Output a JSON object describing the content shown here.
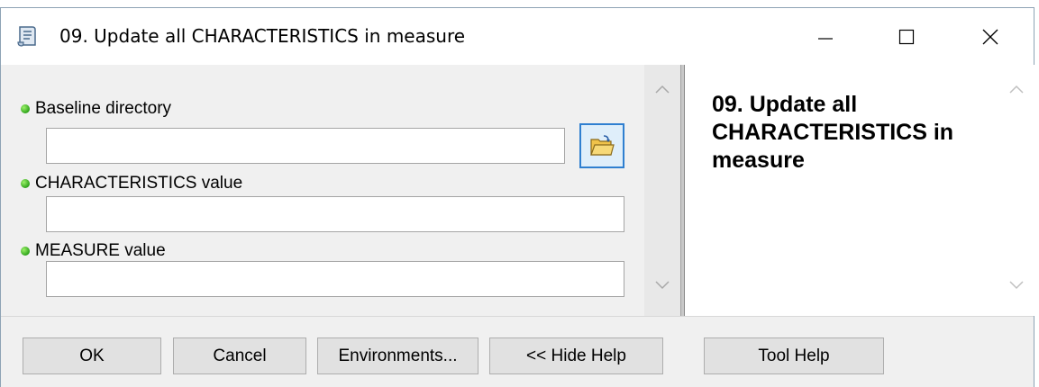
{
  "window": {
    "title": "09. Update all CHARACTERISTICS in measure",
    "icons": {
      "app": "script-tool-icon",
      "minimize": "minimize-icon",
      "maximize": "maximize-icon",
      "close": "close-icon"
    }
  },
  "parameters": [
    {
      "label": "Baseline directory",
      "value": "",
      "status": "required",
      "has_browse": true
    },
    {
      "label": "CHARACTERISTICS value",
      "value": ""
    },
    {
      "label": "MEASURE value",
      "value": ""
    }
  ],
  "browse_icon": "open-folder-icon",
  "help": {
    "title": "09. Update all CHARACTERISTICS in measure"
  },
  "buttons": {
    "ok": "OK",
    "cancel": "Cancel",
    "environments": "Environments...",
    "hide_help": "<< Hide Help",
    "tool_help": "Tool Help"
  },
  "colors": {
    "status_dot": "#2ea31a",
    "browse_border": "#2f7fd0",
    "window_border": "#8ea3b5"
  }
}
